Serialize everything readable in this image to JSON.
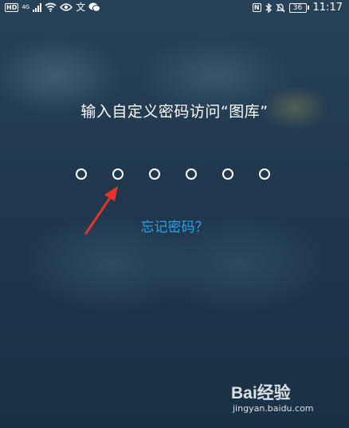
{
  "status_bar": {
    "hd_label": "HD",
    "network_label": "4G",
    "translate_glyph": "文",
    "nfc_label": "N",
    "battery_level": "36",
    "time": "11:17",
    "icons": [
      "signal-icon",
      "wifi-icon",
      "eye-icon",
      "translate-icon",
      "wechat-icon",
      "nfc-icon",
      "bluetooth-icon",
      "mute-icon",
      "battery-icon"
    ]
  },
  "lock": {
    "prompt": "输入自定义密码访问“图库”",
    "pin_length": 6,
    "forgot_label": "忘记密码？"
  },
  "watermark": {
    "logo": "Bai经验",
    "url": "jingyan.baidu.com"
  },
  "colors": {
    "background": "#20394f",
    "accent": "#2aa2ee",
    "arrow": "#e8322e"
  }
}
